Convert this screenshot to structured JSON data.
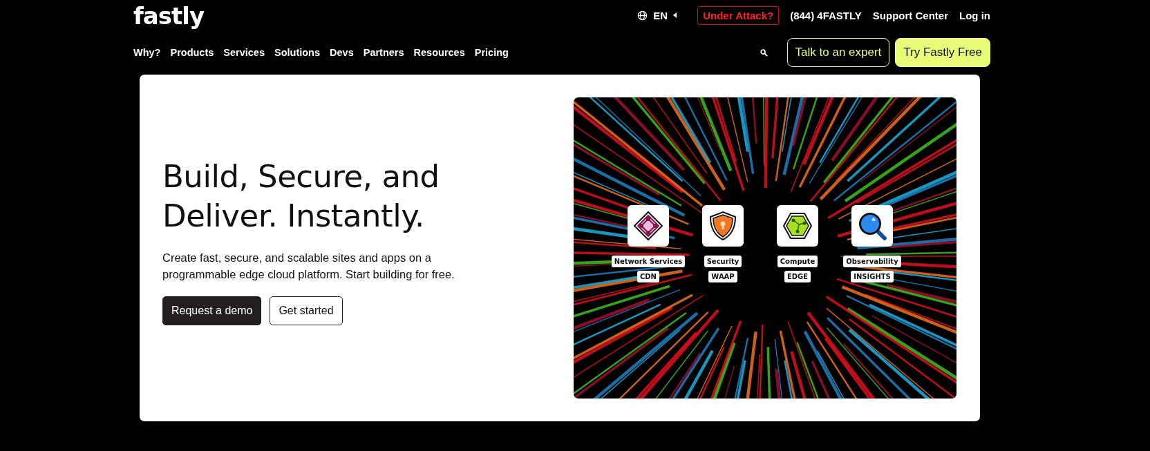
{
  "header": {
    "logo": "fastly",
    "language": "EN",
    "under_attack": "Under Attack?",
    "phone": "(844) 4FASTLY",
    "utility_links": [
      "Support Center",
      "Log in"
    ],
    "nav": [
      "Why?",
      "Products",
      "Services",
      "Solutions",
      "Devs",
      "Partners",
      "Resources",
      "Pricing"
    ],
    "buttons": [
      {
        "label": "Talk to an expert",
        "kind": "outline"
      },
      {
        "label": "Try Fastly Free",
        "kind": "filled"
      }
    ]
  },
  "hero": {
    "title": "Build, Secure, and Deliver. Instantly.",
    "description": "Create fast, secure, and scalable sites and apps on a programmable edge cloud platform. Start building for free.",
    "buttons": [
      {
        "label": "Request a demo",
        "kind": "filled"
      },
      {
        "label": "Get started",
        "kind": "outline"
      }
    ],
    "graphic": {
      "products": [
        {
          "name": "Network Services",
          "tag": "CDN",
          "kind": "network"
        },
        {
          "name": "Security",
          "tag": "WAAP",
          "kind": "security"
        },
        {
          "name": "Compute",
          "tag": "EDGE",
          "kind": "compute"
        },
        {
          "name": "Observability",
          "tag": "INSIGHTS",
          "kind": "observability"
        }
      ]
    }
  }
}
